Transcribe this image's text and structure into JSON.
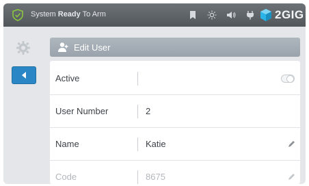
{
  "status_bar": {
    "prefix": "System",
    "state": "Ready",
    "suffix": "To Arm",
    "icons": [
      "bookmark-icon",
      "sun-icon",
      "speaker-icon",
      "plug-icon"
    ],
    "brand": "2GIG",
    "brand_color": "#29b3e6"
  },
  "header": {
    "title": "Edit User"
  },
  "form": {
    "rows": [
      {
        "label": "Active",
        "value": "",
        "control": "toggle",
        "enabled": false
      },
      {
        "label": "User Number",
        "value": "2"
      },
      {
        "label": "Name",
        "value": "Katie",
        "editable": true
      },
      {
        "label": "Code",
        "value": "8675",
        "editable": true
      }
    ]
  },
  "colors": {
    "status_bar": "#5e6368",
    "back_button": "#2a86c4",
    "header_bar": "#a3abb4",
    "shield": "#8cc63f"
  }
}
